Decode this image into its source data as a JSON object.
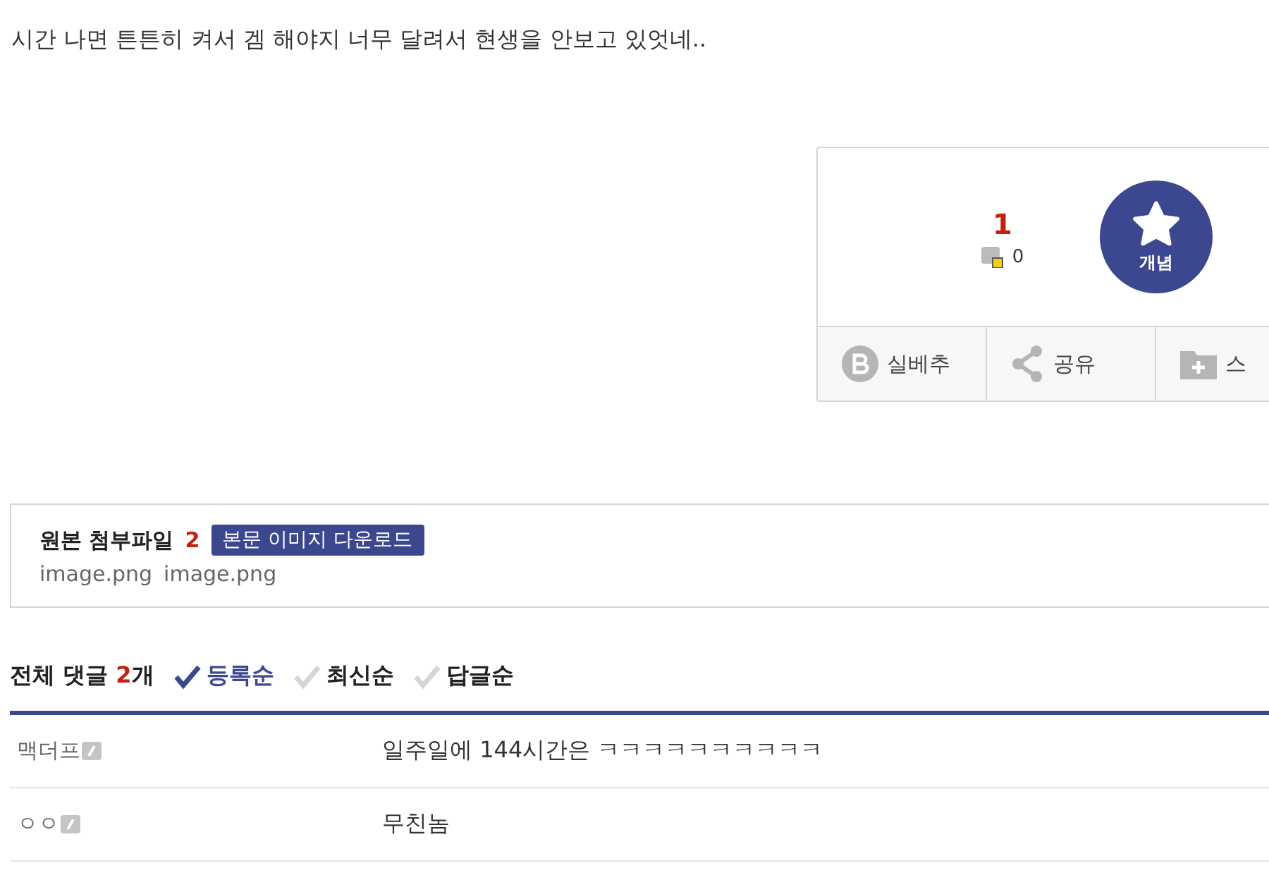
{
  "post_text": "시간 나면 튼튼히 켜서 겜 해야지 너무 달려서 현생을 안보고 있엇네..",
  "recommend": {
    "count": "1",
    "fixed_count": "0",
    "concept_label": "개념",
    "actions": [
      {
        "kind": "blog",
        "label": "실베추"
      },
      {
        "kind": "share",
        "label": "공유"
      },
      {
        "kind": "scrap",
        "label": "스"
      }
    ]
  },
  "attachments": {
    "title": "원본 첨부파일",
    "count": "2",
    "download_label": "본문 이미지 다운로드",
    "files": [
      "image.png",
      "image.png"
    ]
  },
  "comments": {
    "title": "전체 댓글",
    "count": "2",
    "unit": "개",
    "sort": [
      {
        "label": "등록순",
        "selected": true
      },
      {
        "label": "최신순",
        "selected": false
      },
      {
        "label": "답글순",
        "selected": false
      }
    ],
    "rows": [
      {
        "author": "맥더프",
        "text": "일주일에 144시간은 ㅋㅋㅋㅋㅋㅋㅋㅋㅋㅋ"
      },
      {
        "author": "ㅇㅇ",
        "text": "무친놈"
      }
    ]
  }
}
